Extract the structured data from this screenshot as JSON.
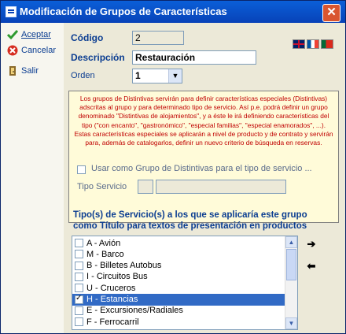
{
  "window": {
    "title": "Modificación de Grupos de Características"
  },
  "sidebar": {
    "accept_label": "Aceptar",
    "cancel_label": "Cancelar",
    "exit_label": "Salir"
  },
  "form": {
    "codigo_label": "Código",
    "codigo_value": "2",
    "descripcion_label": "Descripción",
    "descripcion_value": "Restauración",
    "orden_label": "Orden",
    "orden_value": "1",
    "info_text": "Los grupos de Distintivas servirán para definir características especiales (Distintivas) adscritas al grupo y para determinado tipo de servicio. Así p.e. podrá definir un grupo denominado \"Distintivas de alojamientos\", y a éste le irá definiendo características del tipo (\"con encanto\", \"gastronómico\", \"especial familias\", \"especial enamorados\", ...). Estas características especiales se aplicarán a nivel de producto y de contrato y servirán para, además de catalogarlos, definir un nuevo criterio de búsqueda en reservas.",
    "usar_distintivas_label": "Usar como Grupo de Distintivas para el tipo de servicio ...",
    "tipo_servicio_label": "Tipo Servicio"
  },
  "services": {
    "title_line1": "Tipo(s) de Servicio(s) a los que se aplicaría este grupo",
    "title_line2": "como Título para textos de presentación en productos",
    "items": [
      {
        "label": "A - Avión",
        "checked": false,
        "selected": false
      },
      {
        "label": "M - Barco",
        "checked": false,
        "selected": false
      },
      {
        "label": "B - Billetes Autobus",
        "checked": false,
        "selected": false
      },
      {
        "label": "I - Circuitos Bus",
        "checked": false,
        "selected": false
      },
      {
        "label": "U - Cruceros",
        "checked": false,
        "selected": false
      },
      {
        "label": "H - Estancias",
        "checked": true,
        "selected": true
      },
      {
        "label": "E - Excursiones/Radiales",
        "checked": false,
        "selected": false
      },
      {
        "label": "F - Ferrocarril",
        "checked": false,
        "selected": false
      }
    ]
  },
  "colors": {
    "title_bar": "#0842b8",
    "label_blue": "#0b3d91",
    "info_red": "#c00000",
    "selected": "#316ac5"
  }
}
